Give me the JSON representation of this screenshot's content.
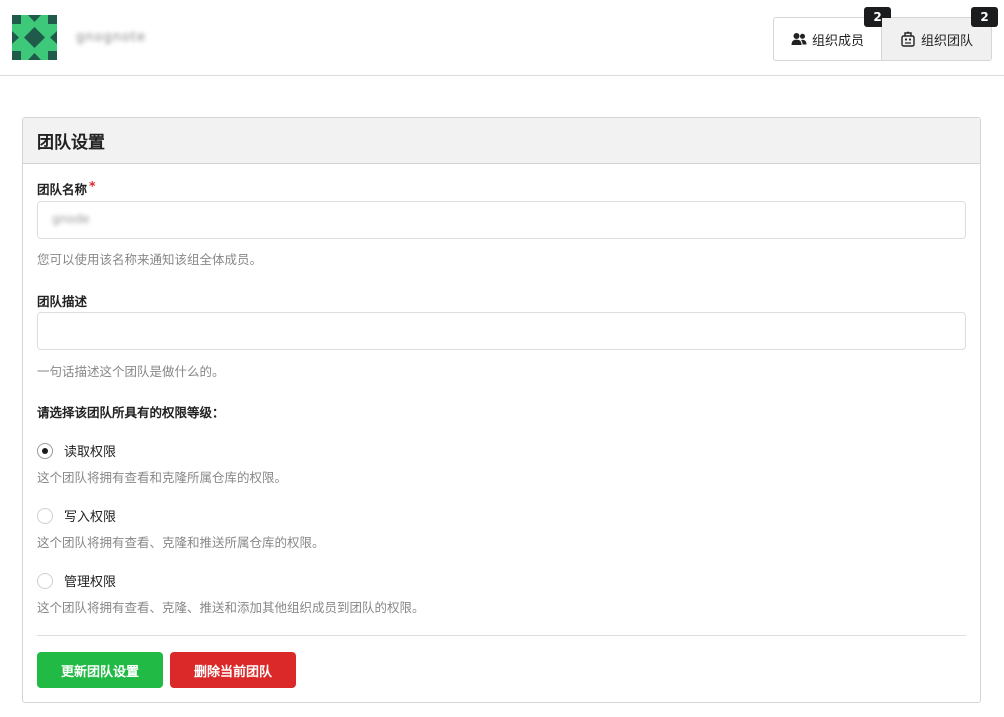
{
  "header": {
    "org_name": "gnognote",
    "tabs": [
      {
        "label": "组织成员",
        "icon": "users-icon",
        "count": "2"
      },
      {
        "label": "组织团队",
        "icon": "team-icon",
        "count": "2"
      }
    ]
  },
  "colors": {
    "logo_dark": "#1f5a4a",
    "logo_light": "#3ec97a",
    "primary": "#21ba45",
    "danger": "#db2828"
  },
  "panel": {
    "title": "团队设置",
    "team_name": {
      "label": "团队名称",
      "required_mark": "*",
      "value": "gnode",
      "help": "您可以使用该名称来通知该组全体成员。"
    },
    "team_desc": {
      "label": "团队描述",
      "value": "",
      "help": "一句话描述这个团队是做什么的。"
    },
    "permission": {
      "label": "请选择该团队所具有的权限等级：",
      "options": [
        {
          "label": "读取权限",
          "checked": true,
          "help": "这个团队将拥有查看和克隆所属仓库的权限。"
        },
        {
          "label": "写入权限",
          "checked": false,
          "help": "这个团队将拥有查看、克隆和推送所属仓库的权限。"
        },
        {
          "label": "管理权限",
          "checked": false,
          "help": "这个团队将拥有查看、克隆、推送和添加其他组织成员到团队的权限。"
        }
      ]
    },
    "buttons": {
      "update": "更新团队设置",
      "delete": "删除当前团队"
    }
  }
}
